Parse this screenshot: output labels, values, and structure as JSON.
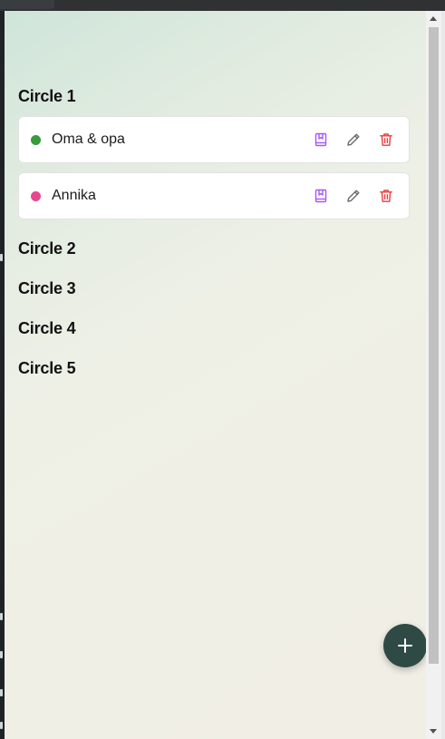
{
  "circles": [
    {
      "heading": "Circle 1",
      "members": [
        {
          "name": "Oma & opa",
          "dot_color": "#3a9b3a"
        },
        {
          "name": "Annika",
          "dot_color": "#e8478f"
        }
      ]
    },
    {
      "heading": "Circle 2",
      "members": []
    },
    {
      "heading": "Circle 3",
      "members": []
    },
    {
      "heading": "Circle 4",
      "members": []
    },
    {
      "heading": "Circle 5",
      "members": []
    }
  ],
  "icons": {
    "journal": "journal-icon",
    "edit": "pencil-icon",
    "delete": "trash-icon",
    "add": "plus-icon"
  },
  "colors": {
    "journal_icon": "#a855f7",
    "edit_icon": "#6b6b6b",
    "delete_icon": "#e53e3e",
    "fab_background": "#2f4a45"
  }
}
